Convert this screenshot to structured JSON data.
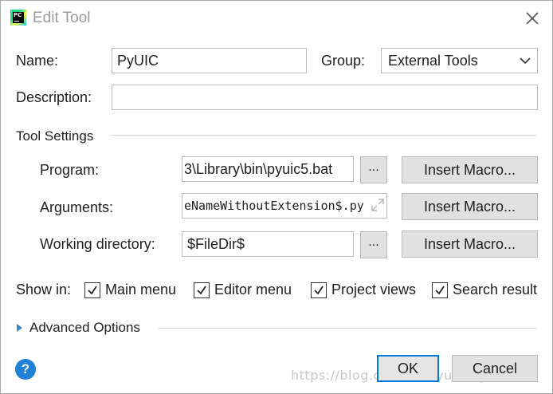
{
  "window": {
    "title": "Edit Tool",
    "close_icon": "close-icon",
    "app_icon_text": "PC"
  },
  "name": {
    "label": "Name:",
    "value": "PyUIC"
  },
  "group": {
    "label": "Group:",
    "selected": "External Tools"
  },
  "description": {
    "label": "Description:",
    "value": ""
  },
  "tool_settings": {
    "header": "Tool Settings",
    "program": {
      "label": "Program:",
      "value": "3\\Library\\bin\\pyuic5.bat",
      "browse_label": "...",
      "macro_label": "Insert Macro..."
    },
    "arguments": {
      "label": "Arguments:",
      "value": "eNameWithoutExtension$.py",
      "macro_label": "Insert Macro..."
    },
    "working_directory": {
      "label": "Working directory:",
      "value": "$FileDir$",
      "browse_label": "...",
      "macro_label": "Insert Macro..."
    }
  },
  "show_in": {
    "label": "Show in:",
    "options": [
      {
        "label": "Main menu",
        "checked": true
      },
      {
        "label": "Editor menu",
        "checked": true
      },
      {
        "label": "Project views",
        "checked": true
      },
      {
        "label": "Search result",
        "checked": true
      }
    ]
  },
  "advanced": {
    "label": "Advanced Options",
    "expanded": false
  },
  "buttons": {
    "ok": "OK",
    "cancel": "Cancel",
    "help": "?"
  },
  "watermark": "https://blog.csdn.net/yuming2055",
  "colors": {
    "accent": "#0078d7",
    "help": "#1e7fd6"
  }
}
